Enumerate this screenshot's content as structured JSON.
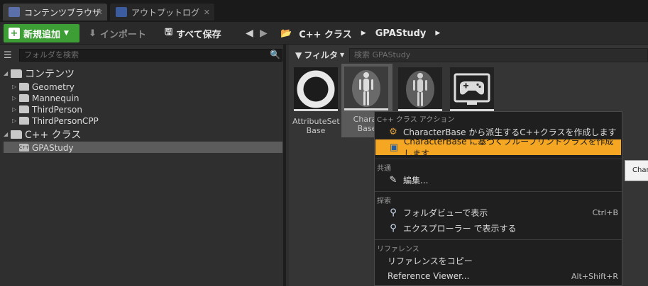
{
  "tabs": [
    {
      "label": "コンテンツブラウザ",
      "close": "✕",
      "icon": "content-browser-icon"
    },
    {
      "label": "アウトプットログ",
      "close": "✕",
      "icon": "output-log-icon"
    }
  ],
  "toolbar": {
    "add_new": "新規追加",
    "import": "インポート",
    "save_all": "すべて保存"
  },
  "breadcrumb": [
    "C++ クラス",
    "GPAStudy"
  ],
  "left_panel": {
    "search_placeholder": "フォルダを検索",
    "tree": {
      "contents": "コンテンツ",
      "geometry": "Geometry",
      "mannequin": "Mannequin",
      "thirdperson": "ThirdPerson",
      "thirdpersoncpp": "ThirdPersonCPP",
      "cpp_classes": "C++ クラス",
      "gpastudy": "GPAStudy"
    }
  },
  "right_panel": {
    "filter_label": "フィルタ",
    "search_placeholder": "検索 GPAStudy",
    "assets": [
      {
        "line1": "AttributeSet",
        "line2": "Base"
      },
      {
        "line1": "Charac",
        "line2": "Base"
      },
      {
        "line1": "",
        "line2": ""
      },
      {
        "line1": "",
        "line2": ""
      }
    ]
  },
  "context_menu": {
    "section_cpp": "C++ クラス アクション",
    "derive_cpp": "CharacterBase から派生するC++クラスを作成します",
    "create_blueprint": "CharacterBase に基づくブループリントクラスを作成します",
    "section_common": "共通",
    "edit": "編集...",
    "section_explore": "探索",
    "folder_view": "フォルダビューで表示",
    "folder_view_shortcut": "Ctrl+B",
    "explorer": "エクスプローラー で表示する",
    "section_reference": "リファレンス",
    "copy_reference": "リファレンスをコピー",
    "reference_viewer": "Reference Viewer...",
    "reference_viewer_shortcut": "Alt+Shift+R"
  },
  "tooltip": "Char",
  "colors": {
    "accent_green": "#3e9e36",
    "highlight_orange": "#f5a623"
  }
}
